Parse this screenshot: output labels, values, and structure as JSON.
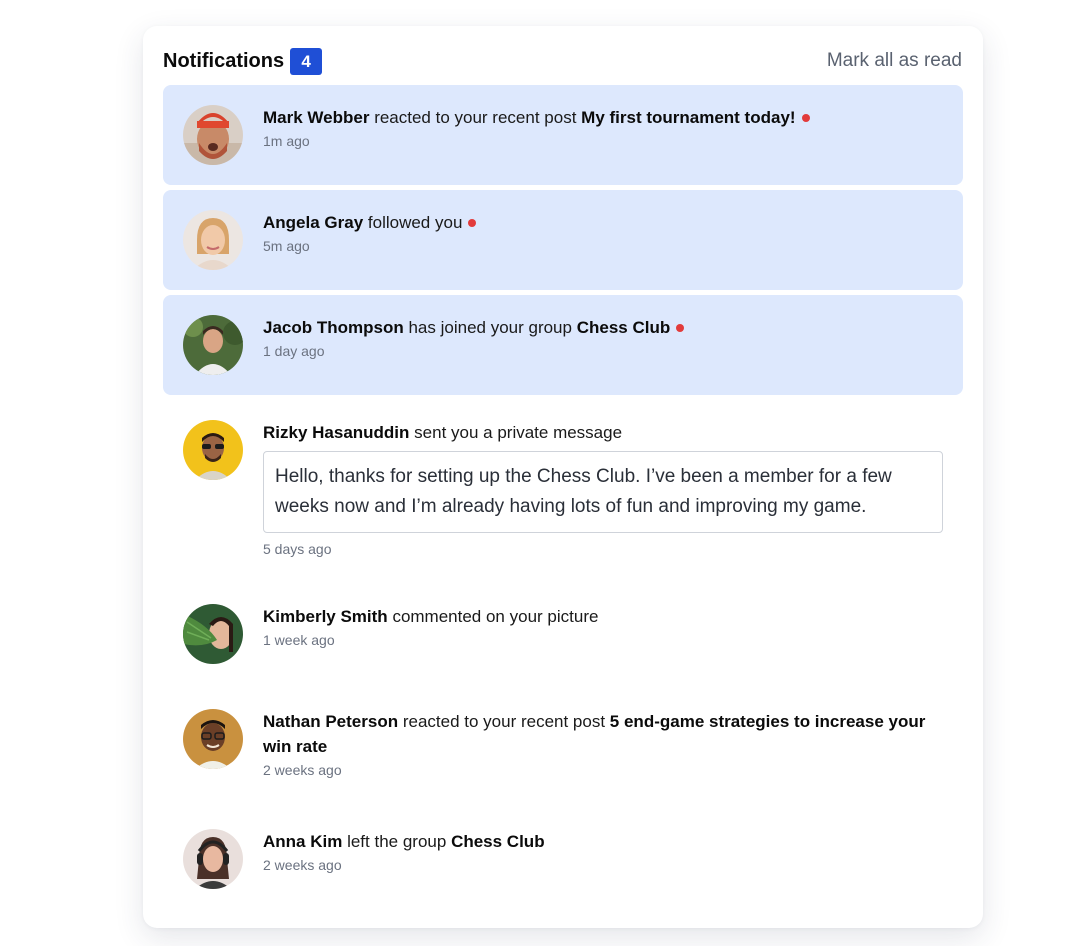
{
  "header": {
    "title": "Notifications",
    "count": "4",
    "mark_all_label": "Mark all as read"
  },
  "notifications": [
    {
      "name": "Mark Webber",
      "action": "reacted to your recent post",
      "target": "My first tournament today!",
      "time": "1m ago",
      "unread": true
    },
    {
      "name": "Angela Gray",
      "action": "followed you",
      "target": "",
      "time": "5m ago",
      "unread": true
    },
    {
      "name": "Jacob Thompson",
      "action": "has joined your group",
      "target": "Chess Club",
      "time": "1 day ago",
      "unread": true
    },
    {
      "name": "Rizky Hasanuddin",
      "action": "sent you a private message",
      "target": "",
      "message": "Hello, thanks for setting up the Chess Club. I’ve been a member for a few weeks now and I’m already having lots of fun and improving my game.",
      "time": "5 days ago",
      "unread": false
    },
    {
      "name": "Kimberly Smith",
      "action": "commented on your picture",
      "target": "",
      "time": "1 week ago",
      "unread": false
    },
    {
      "name": "Nathan Peterson",
      "action": "reacted to your recent post",
      "target": "5 end-game strategies to increase your win rate",
      "time": "2 weeks ago",
      "unread": false
    },
    {
      "name": "Anna Kim",
      "action": "left the group",
      "target": "Chess Club",
      "time": "2 weeks ago",
      "unread": false
    }
  ],
  "colors": {
    "accent": "#1f4fd6",
    "unread_bg": "#dde8fd",
    "unread_dot": "#e23b3b"
  }
}
